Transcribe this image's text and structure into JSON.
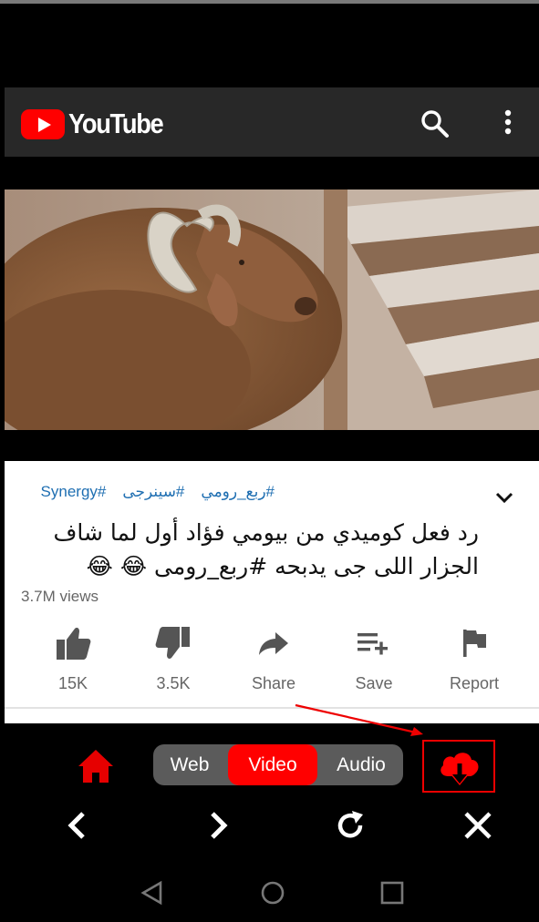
{
  "header": {
    "brand": "YouTube",
    "brand_icon": "youtube-play-icon",
    "search_icon": "search-icon",
    "more_icon": "more-vertical-icon"
  },
  "video": {
    "hashtags": [
      "#ربع_رومي",
      "#سينرجى",
      "#Synergy"
    ],
    "title": "رد فعل كوميدي من بيومي فؤاد أول لما شاف الجزار اللى جى يدبحه #ربع_رومى 😂 😂",
    "views": "3.7M views"
  },
  "actions": [
    {
      "label": "15K",
      "icon": "thumbs-up-icon"
    },
    {
      "label": "3.5K",
      "icon": "thumbs-down-icon"
    },
    {
      "label": "Share",
      "icon": "share-icon"
    },
    {
      "label": "Save",
      "icon": "add-to-playlist-icon"
    },
    {
      "label": "Report",
      "icon": "flag-icon"
    }
  ],
  "toolbar": {
    "modes": {
      "web": "Web",
      "video": "Video",
      "audio": "Audio"
    },
    "selected_mode": "Video",
    "home_icon": "home-icon",
    "download_icon": "cloud-download-icon"
  },
  "nav": {
    "back_icon": "chevron-left-icon",
    "forward_icon": "chevron-right-icon",
    "refresh_icon": "refresh-icon",
    "close_icon": "close-icon"
  },
  "system_nav": {
    "back": "triangle-back-icon",
    "home": "circle-home-icon",
    "recents": "square-recents-icon"
  },
  "colors": {
    "accent": "#ff0000",
    "header_bg": "#282828",
    "hashtag": "#1f6fb2",
    "muted_text": "#666666"
  }
}
